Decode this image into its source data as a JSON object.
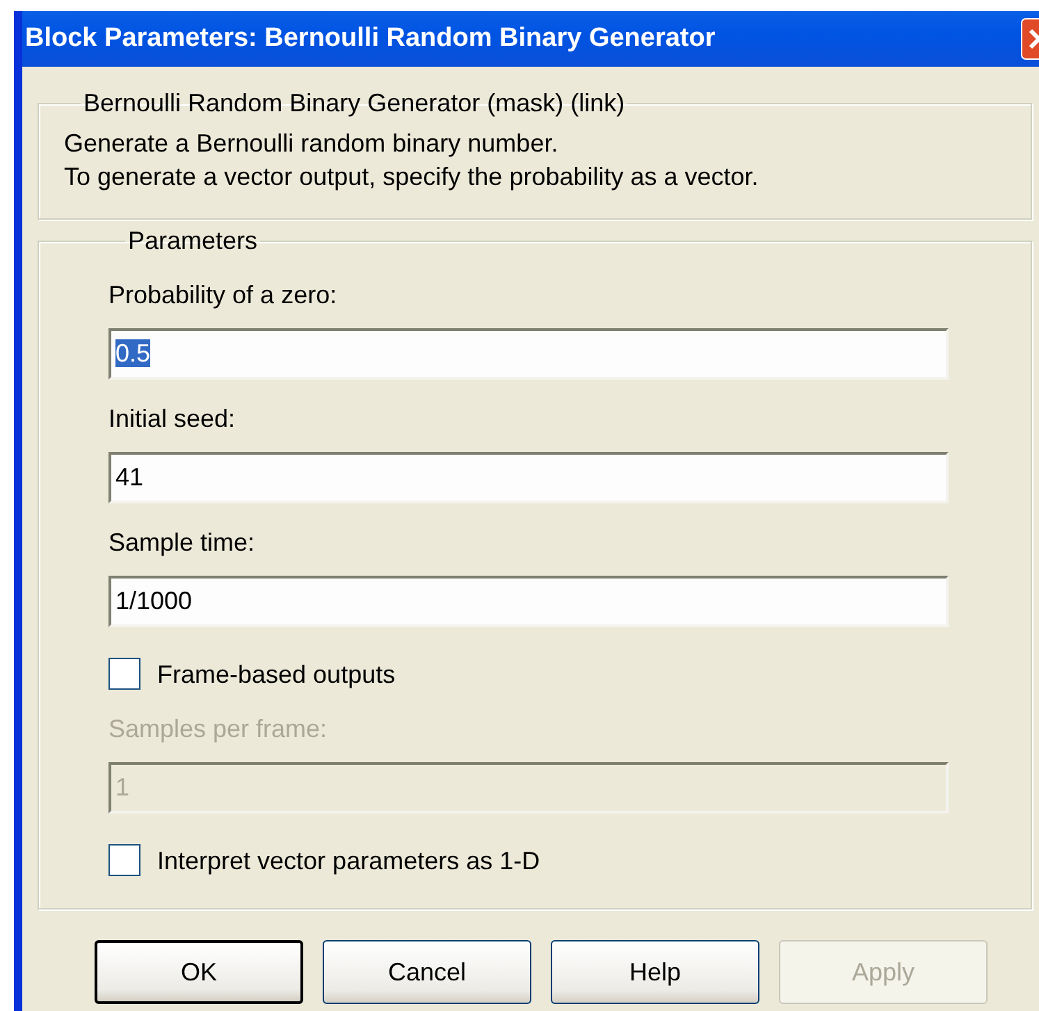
{
  "window": {
    "title": "Block Parameters: Bernoulli Random Binary Generator"
  },
  "description_group": {
    "title": "Bernoulli Random Binary Generator (mask) (link)",
    "lines": [
      "Generate a Bernoulli random binary number.",
      "To generate a vector output, specify the probability as a vector."
    ]
  },
  "parameters": {
    "title": "Parameters",
    "items": [
      {
        "kind": "field",
        "label": "Probability of a zero:",
        "value": "0.5",
        "text_selected": true,
        "disabled": false
      },
      {
        "kind": "field",
        "label": "Initial seed:",
        "value": "41",
        "text_selected": false,
        "disabled": false
      },
      {
        "kind": "field",
        "label": "Sample time:",
        "value": "1/1000",
        "text_selected": false,
        "disabled": false
      },
      {
        "kind": "checkbox",
        "label": "Frame-based outputs",
        "checked": false
      },
      {
        "kind": "field",
        "label": "Samples per frame:",
        "value": "1",
        "text_selected": false,
        "disabled": true
      },
      {
        "kind": "checkbox",
        "label": "Interpret vector parameters as 1-D",
        "checked": false
      }
    ]
  },
  "buttons": [
    {
      "label": "OK",
      "default": true,
      "disabled": false
    },
    {
      "label": "Cancel",
      "default": false,
      "disabled": false
    },
    {
      "label": "Help",
      "default": false,
      "disabled": false
    },
    {
      "label": "Apply",
      "default": false,
      "disabled": true
    }
  ]
}
